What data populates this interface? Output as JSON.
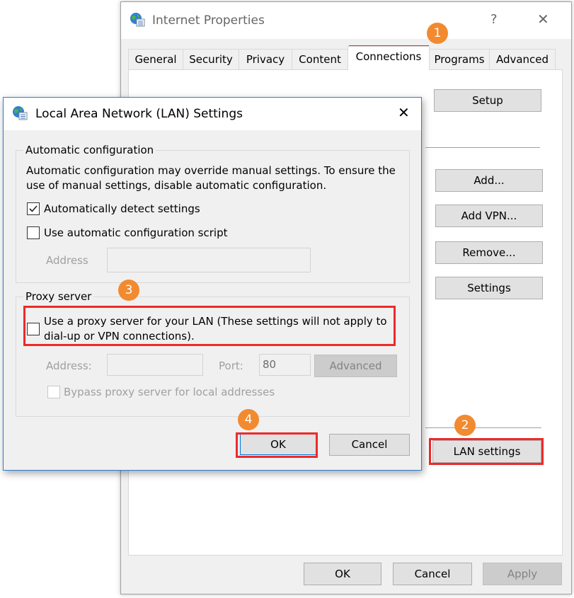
{
  "outer_window": {
    "title": "Internet Properties",
    "help_label": "?",
    "close_label": "✕",
    "icon": "internet-options-globe-icon",
    "tabs": [
      {
        "label": "General",
        "active": false
      },
      {
        "label": "Security",
        "active": false
      },
      {
        "label": "Privacy",
        "active": false
      },
      {
        "label": "Content",
        "active": false
      },
      {
        "label": "Connections",
        "active": true
      },
      {
        "label": "Programs",
        "active": false
      },
      {
        "label": "Advanced",
        "active": false
      }
    ],
    "buttons": {
      "setup": "Setup",
      "add": "Add...",
      "add_vpn": "Add VPN...",
      "remove": "Remove...",
      "settings": "Settings",
      "lan_settings": "LAN settings"
    },
    "footer": {
      "ok": "OK",
      "cancel": "Cancel",
      "apply": "Apply"
    }
  },
  "lan_dialog": {
    "title": "Local Area Network (LAN) Settings",
    "close_label": "✕",
    "auto_config": {
      "legend": "Automatic configuration",
      "description_line1": "Automatic configuration may override manual settings.  To ensure the",
      "description_line2": "use of manual settings, disable automatic configuration.",
      "auto_detect_label": "Automatically detect settings",
      "auto_detect_checked": true,
      "use_script_label": "Use automatic configuration script",
      "use_script_checked": false,
      "address_label": "Address",
      "address_value": ""
    },
    "proxy": {
      "legend": "Proxy server",
      "use_proxy_line1": "Use a proxy server for your LAN (These settings will not apply to",
      "use_proxy_line2": "dial-up or VPN connections).",
      "use_proxy_checked": false,
      "address_label": "Address:",
      "address_value": "",
      "port_label": "Port:",
      "port_value": "80",
      "advanced_label": "Advanced",
      "bypass_label": "Bypass proxy server for local addresses",
      "bypass_checked": false
    },
    "ok": "OK",
    "cancel": "Cancel"
  },
  "annotations": {
    "color_badge": "#f28a30",
    "color_highlight": "#ee2a2a",
    "steps": [
      "1",
      "2",
      "3",
      "4"
    ]
  }
}
